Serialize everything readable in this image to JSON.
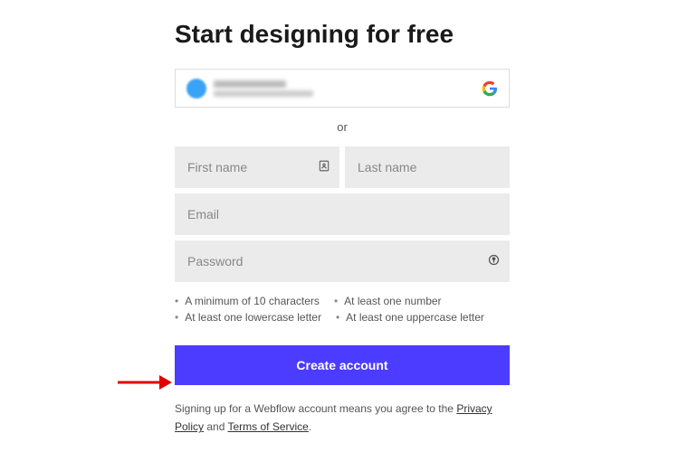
{
  "heading": "Start designing for free",
  "divider_text": "or",
  "fields": {
    "first_name_placeholder": "First name",
    "last_name_placeholder": "Last name",
    "email_placeholder": "Email",
    "password_placeholder": "Password"
  },
  "password_hints": [
    "A minimum of 10 characters",
    "At least one number",
    "At least one lowercase letter",
    "At least one uppercase letter"
  ],
  "create_button": "Create account",
  "legal": {
    "prefix": "Signing up for a Webflow account means you agree to the ",
    "privacy": "Privacy Policy",
    "mid": " and ",
    "terms": "Terms of Service",
    "suffix": "."
  }
}
